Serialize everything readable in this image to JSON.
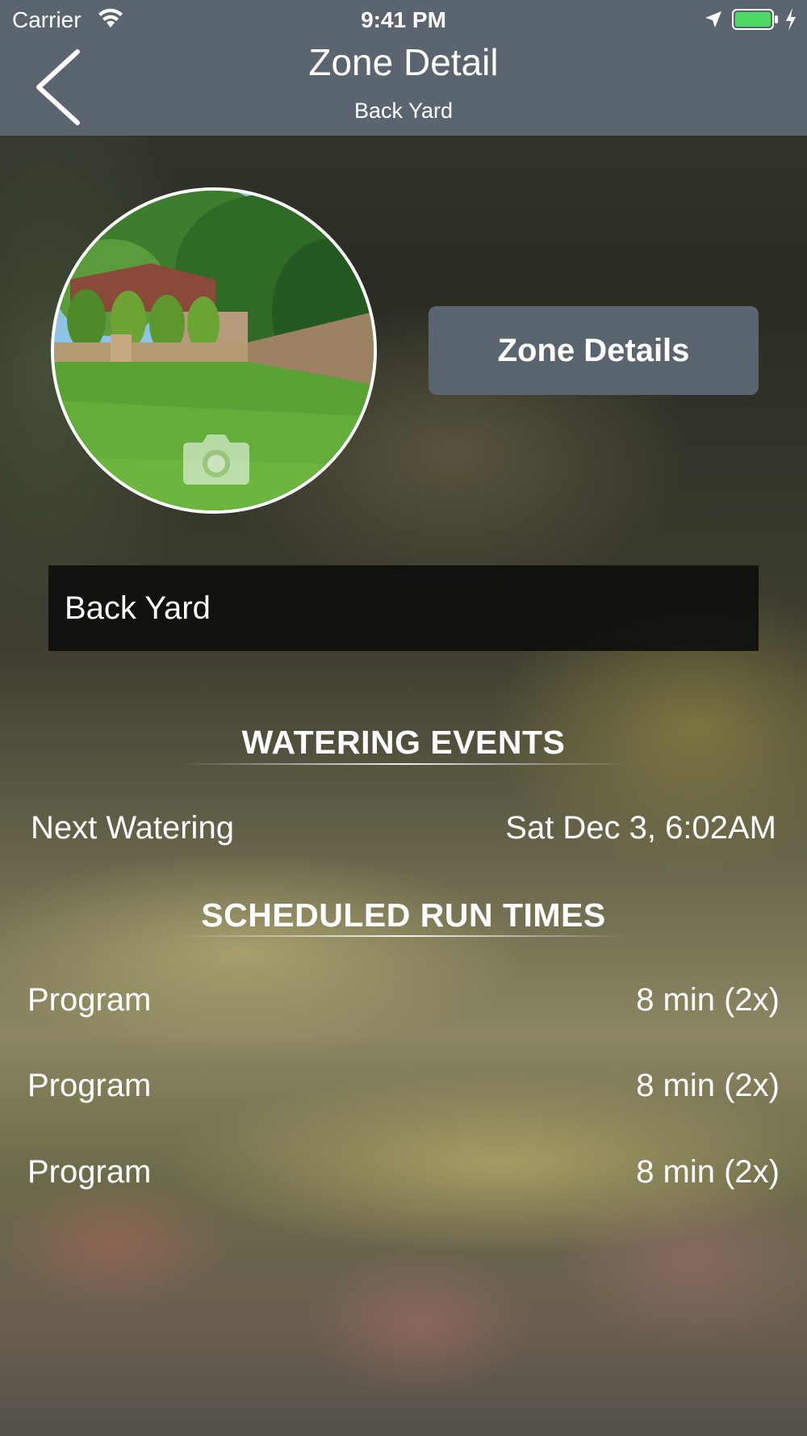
{
  "status_bar": {
    "carrier": "Carrier",
    "time": "9:41 PM",
    "icons": [
      "wifi-icon",
      "location-arrow-icon",
      "battery-icon",
      "charging-bolt-icon"
    ]
  },
  "nav": {
    "title": "Zone Detail",
    "subtitle": "Back Yard",
    "back_icon": "chevron-left-icon",
    "bar_color": "#5b6570"
  },
  "zone": {
    "photo_overlay_icon": "camera-icon",
    "details_button_label": "Zone Details",
    "name_value": "Back Yard"
  },
  "watering_events": {
    "heading": "WATERING EVENTS",
    "next_label": "Next Watering",
    "next_value": "Sat Dec 3, 6:02AM"
  },
  "scheduled_run_times": {
    "heading": "SCHEDULED RUN TIMES",
    "items": [
      {
        "label": "Program",
        "value": "8 min (2x)"
      },
      {
        "label": "Program",
        "value": "8 min (2x)"
      },
      {
        "label": "Program",
        "value": "8 min (2x)"
      }
    ]
  },
  "colors": {
    "accent": "#5b6570",
    "battery": "#4cd964",
    "text": "#ffffff"
  }
}
